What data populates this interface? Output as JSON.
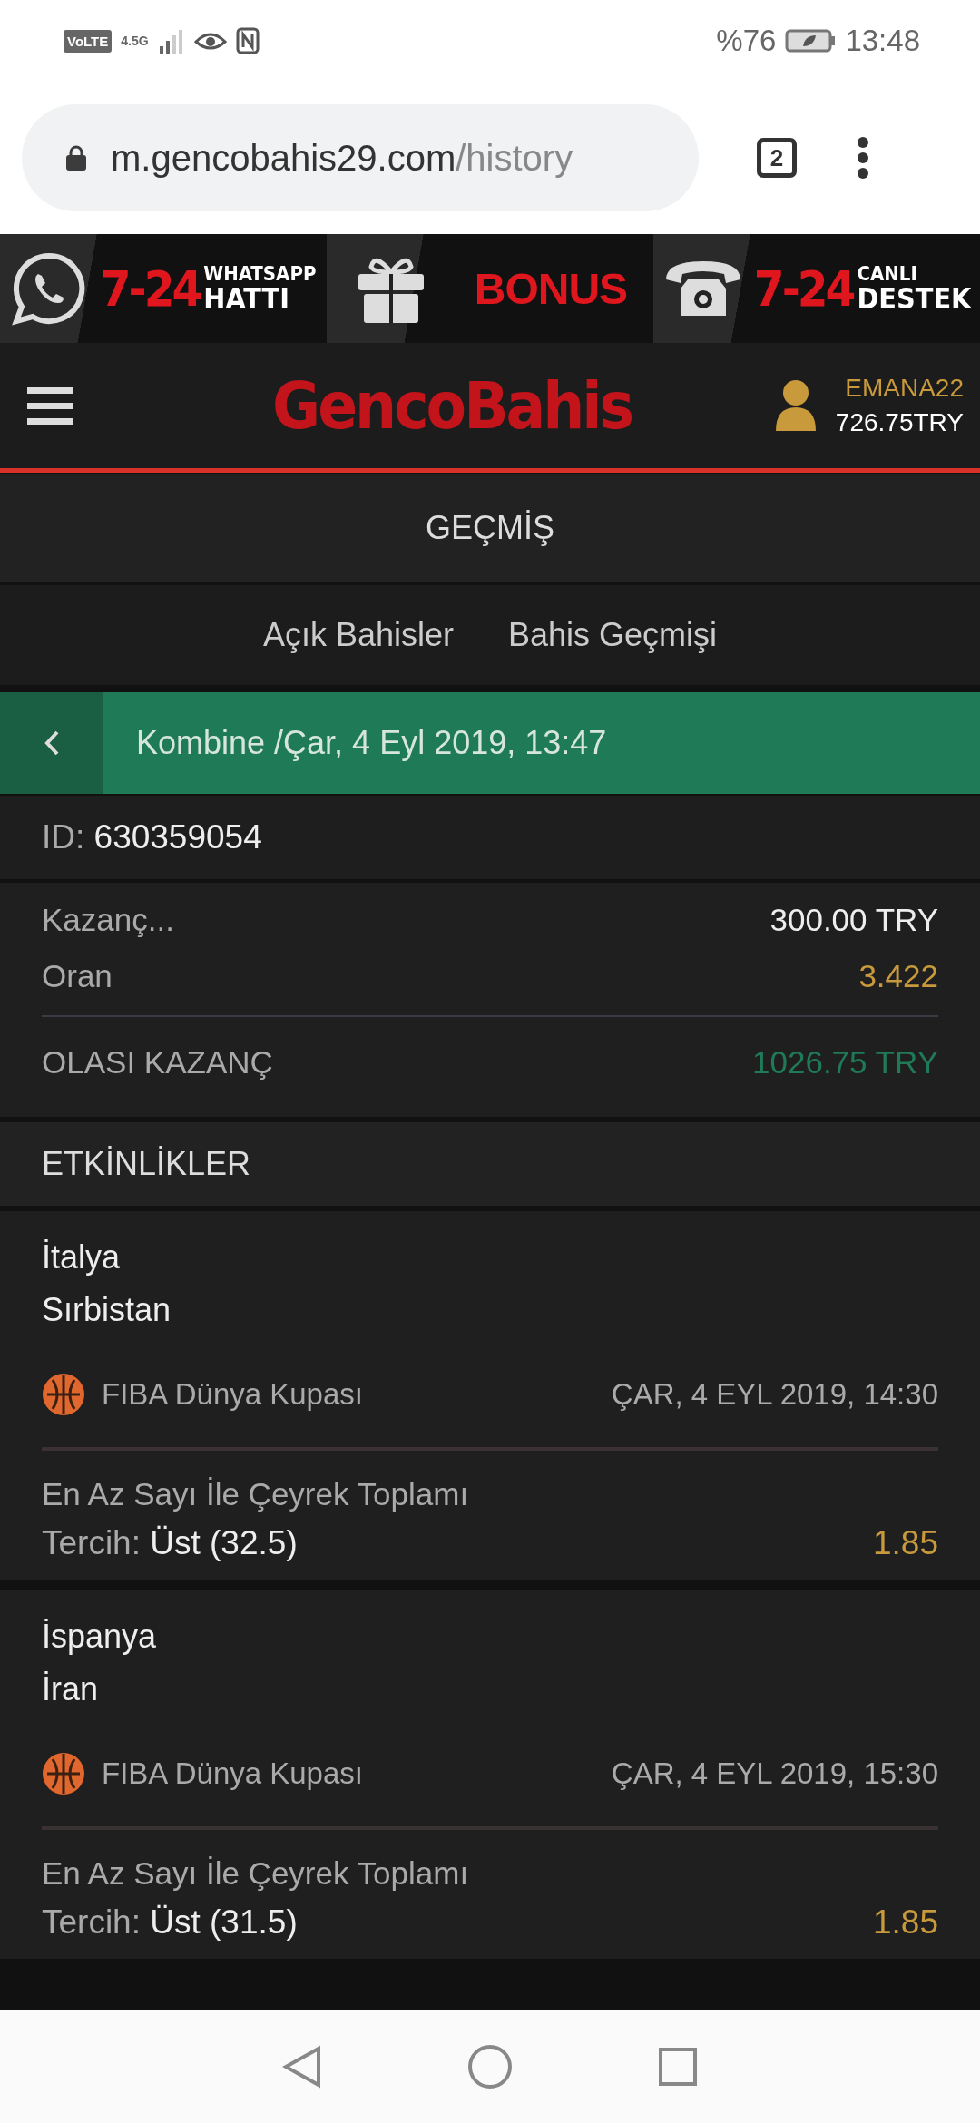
{
  "status_bar": {
    "network_badges": [
      "VoLTE",
      "4.5G"
    ],
    "battery": "%76",
    "time": "13:48"
  },
  "browser": {
    "url_host": "m.gencobahis29.com",
    "url_path": "/history",
    "tab_count": "2"
  },
  "banner": [
    {
      "kind": "whatsapp",
      "number": "7-24",
      "line1": "WHATSAPP",
      "line2": "HATTI"
    },
    {
      "kind": "gift",
      "text": "BONUS"
    },
    {
      "kind": "phone",
      "number": "7-24",
      "line1": "CANLI",
      "line2": "DESTEK"
    }
  ],
  "header": {
    "logo": "GencoBahis",
    "username": "EMANA22",
    "balance": "726.75TRY"
  },
  "page_title": "GEÇMİŞ",
  "tabs": [
    {
      "label": "Açık Bahisler",
      "selected": false
    },
    {
      "label": "Bahis Geçmişi",
      "selected": false
    }
  ],
  "bet": {
    "title": "Kombine /Çar, 4 Eyl 2019, 13:47",
    "id_label": "ID:",
    "id": "630359054",
    "stake_label": "Kazanç...",
    "stake": "300.00 TRY",
    "odds_label": "Oran",
    "odds": "3.422",
    "payout_label": "OLASI KAZANÇ",
    "payout": "1026.75 TRY"
  },
  "events_title": "ETKİNLİKLER",
  "events": [
    {
      "home": "İtalya",
      "away": "Sırbistan",
      "league": "FIBA Dünya Kupası",
      "date": "ÇAR, 4 EYL 2019, 14:30",
      "market": "En Az Sayı İle Çeyrek Toplamı",
      "choice_label": "Tercih:",
      "choice": "Üst (32.5)",
      "odds": "1.85"
    },
    {
      "home": "İspanya",
      "away": "İran",
      "league": "FIBA Dünya Kupası",
      "date": "ÇAR, 4 EYL 2019, 15:30",
      "market": "En Az Sayı İle Çeyrek Toplamı",
      "choice_label": "Tercih:",
      "choice": "Üst (31.5)",
      "odds": "1.85"
    }
  ]
}
